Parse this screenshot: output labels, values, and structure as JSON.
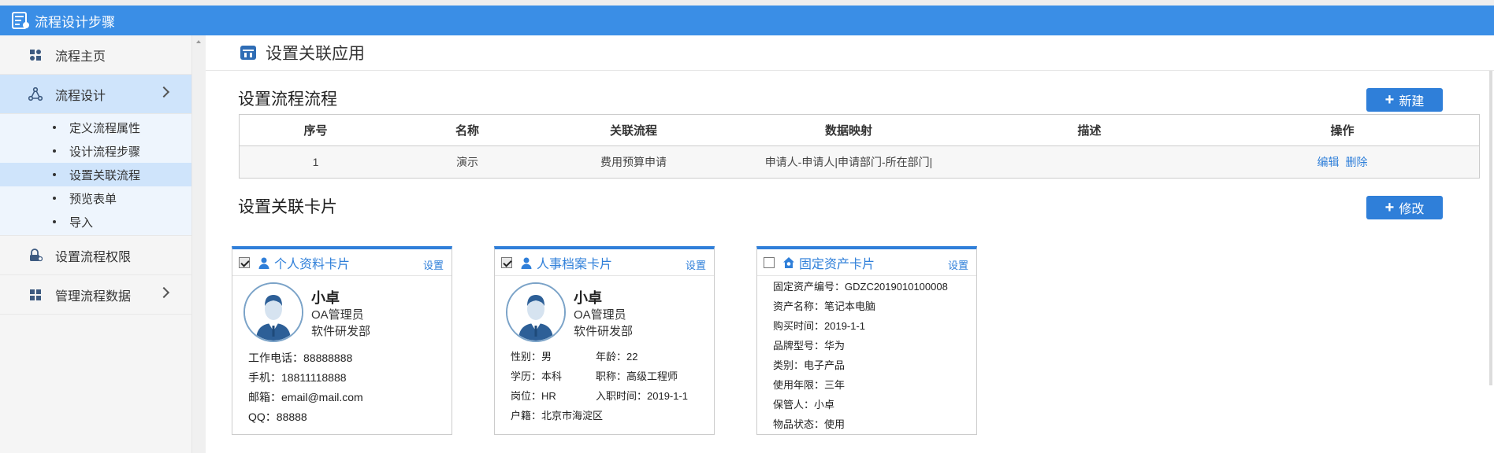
{
  "app": {
    "title": "流程设计步骤"
  },
  "sidebar": {
    "items": [
      {
        "label": "流程主页",
        "icon": "puzzle-icon"
      },
      {
        "label": "流程设计",
        "icon": "share-icon",
        "active": true,
        "expandable": true
      },
      {
        "label": "设置流程权限",
        "icon": "lock-user-icon"
      },
      {
        "label": "管理流程数据",
        "icon": "grid-icon",
        "expandable": true
      }
    ],
    "subitems": [
      {
        "label": "定义流程属性"
      },
      {
        "label": "设计流程步骤"
      },
      {
        "label": "设置关联流程",
        "active": true
      },
      {
        "label": "预览表单"
      },
      {
        "label": "导入"
      }
    ]
  },
  "page": {
    "title": "设置关联应用"
  },
  "flow_section": {
    "title": "设置流程流程",
    "new_button": "新建",
    "headers": [
      "序号",
      "名称",
      "关联流程",
      "数据映射",
      "描述",
      "操作"
    ],
    "rows": [
      {
        "index": "1",
        "name": "演示",
        "flow": "费用预算申请",
        "mapping": "申请人-申请人|申请部门-所在部门|",
        "desc": "",
        "edit": "编辑",
        "delete": "删除"
      }
    ]
  },
  "card_section": {
    "title": "设置关联卡片",
    "modify_button": "修改",
    "cards": [
      {
        "title": "个人资料卡片",
        "setting": "设置",
        "checked": true,
        "name": "小卓",
        "role": "OA管理员",
        "dept": "软件研发部",
        "fields": [
          "工作电话：88888888",
          "手机：18811118888",
          "邮箱：email@mail.com",
          "QQ：88888"
        ]
      },
      {
        "title": "人事档案卡片",
        "setting": "设置",
        "checked": true,
        "name": "小卓",
        "role": "OA管理员",
        "dept": "软件研发部",
        "pairs": [
          [
            "性别：男",
            "年龄：22"
          ],
          [
            "学历：本科",
            "职称：高级工程师"
          ],
          [
            "岗位：HR",
            "入职时间：2019-1-1"
          ],
          [
            "户籍：北京市海淀区",
            ""
          ]
        ]
      },
      {
        "title": "固定资产卡片",
        "setting": "设置",
        "checked": false,
        "fields": [
          "固定资产编号：GDZC2019010100008",
          "资产名称：笔记本电脑",
          "购买时间：2019-1-1",
          "品牌型号：华为",
          "类别：电子产品",
          "使用年限：三年",
          "保管人：小卓",
          "物品状态：使用"
        ]
      }
    ]
  },
  "colors": {
    "titlebar": "#3a8ee6",
    "accent": "#2f7fd9",
    "active_menu": "#cfe4fb"
  }
}
